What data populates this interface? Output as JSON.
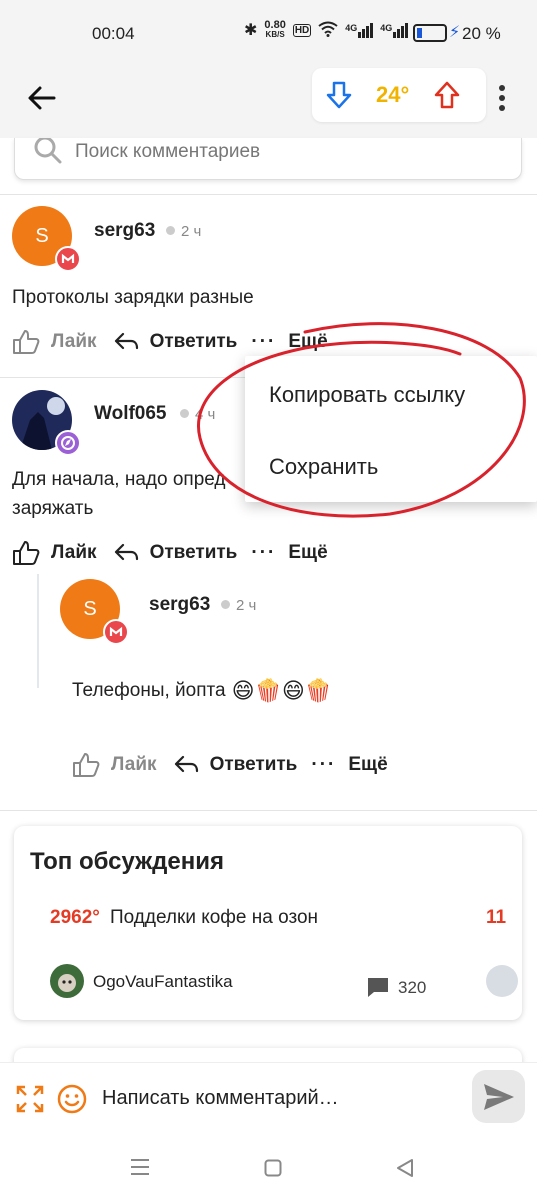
{
  "status_bar": {
    "time": "00:04",
    "net_speed": "0.80",
    "net_unit": "KB/S",
    "hd": "HD",
    "sig1": "4G",
    "sig2": "4G",
    "battery_pct": "20 %",
    "battery_level": 0.2
  },
  "appbar": {
    "score": "24°",
    "colors": {
      "down": "#1a73e8",
      "up": "#e0311e",
      "score": "#f0b400"
    }
  },
  "search": {
    "placeholder": "Поиск комментариев"
  },
  "comments": [
    {
      "user": "serg63",
      "avatar_letter": "S",
      "time": "2 ч",
      "text": "Протоколы зарядки разные",
      "like": "Лайк",
      "reply": "Ответить",
      "more": "Ещё"
    },
    {
      "user": "Wolf065",
      "time": "4 ч",
      "text_line1": "Для начала, надо опред",
      "text_line2": "заряжать",
      "like": "Лайк",
      "reply": "Ответить",
      "more": "Ещё"
    },
    {
      "user": "serg63",
      "avatar_letter": "S",
      "time": "2 ч",
      "text": "Телефоны, йопта",
      "like": "Лайк",
      "reply": "Ответить",
      "more": "Ещё"
    }
  ],
  "context_menu": {
    "items": [
      "Копировать ссылку",
      "Сохранить"
    ]
  },
  "top_discussions": {
    "title": "Топ обсуждения",
    "item": {
      "degrees": "2962°",
      "title": "Подделки кофе на озон",
      "author": "OgoVauFantastika",
      "comments": "320"
    },
    "next_degrees": "11"
  },
  "composer": {
    "placeholder": "Написать комментарий…"
  },
  "colors": {
    "accent_orange": "#ef7a16",
    "hot_red": "#e53b24",
    "annotation_red": "#d8222c"
  }
}
